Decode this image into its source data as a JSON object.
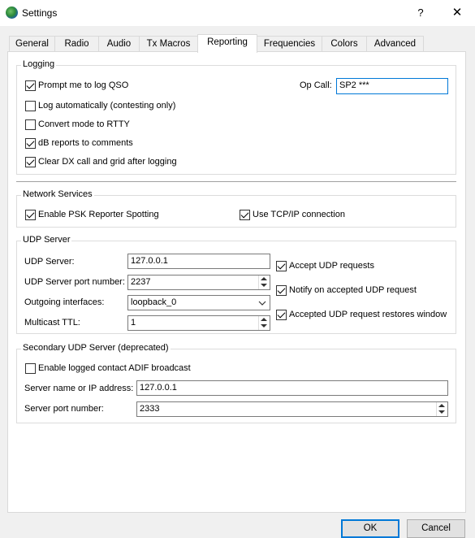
{
  "window": {
    "title": "Settings",
    "help_label": "?",
    "close_label": "✕"
  },
  "tabs": [
    {
      "label": "General"
    },
    {
      "label": "Radio"
    },
    {
      "label": "Audio"
    },
    {
      "label": "Tx Macros"
    },
    {
      "label": "Reporting",
      "active": true
    },
    {
      "label": "Frequencies"
    },
    {
      "label": "Colors"
    },
    {
      "label": "Advanced"
    }
  ],
  "logging": {
    "title": "Logging",
    "prompt_log_qso": {
      "label": "Prompt me to log QSO",
      "checked": true
    },
    "log_automatically": {
      "label": "Log automatically (contesting only)",
      "checked": false
    },
    "convert_rtty": {
      "label": "Convert mode to RTTY",
      "checked": false
    },
    "db_reports": {
      "label": "dB reports to comments",
      "checked": true
    },
    "clear_dx": {
      "label": "Clear DX call and grid after logging",
      "checked": true
    },
    "op_call_label": "Op Call:",
    "op_call_value": "SP2 ***"
  },
  "network": {
    "title": "Network Services",
    "psk_reporter": {
      "label": "Enable PSK Reporter Spotting",
      "checked": true
    },
    "tcp_ip": {
      "label": "Use TCP/IP connection",
      "checked": true
    }
  },
  "udp": {
    "title": "UDP Server",
    "server_label": "UDP Server:",
    "server_value": "127.0.0.1",
    "port_label": "UDP Server port number:",
    "port_value": "2237",
    "interfaces_label": "Outgoing interfaces:",
    "interfaces_value": "loopback_0",
    "ttl_label": "Multicast TTL:",
    "ttl_value": "1",
    "accept_requests": {
      "label": "Accept UDP requests",
      "checked": true
    },
    "notify_accepted": {
      "label": "Notify on accepted UDP request",
      "checked": true
    },
    "restores_window": {
      "label": "Accepted UDP request restores window",
      "checked": true
    }
  },
  "secondary": {
    "title": "Secondary UDP Server (deprecated)",
    "adif_broadcast": {
      "label": "Enable logged contact ADIF broadcast",
      "checked": false
    },
    "server_label": "Server name or IP address:",
    "server_value": "127.0.0.1",
    "port_label": "Server port number:",
    "port_value": "2333"
  },
  "buttons": {
    "ok": "OK",
    "cancel": "Cancel"
  }
}
